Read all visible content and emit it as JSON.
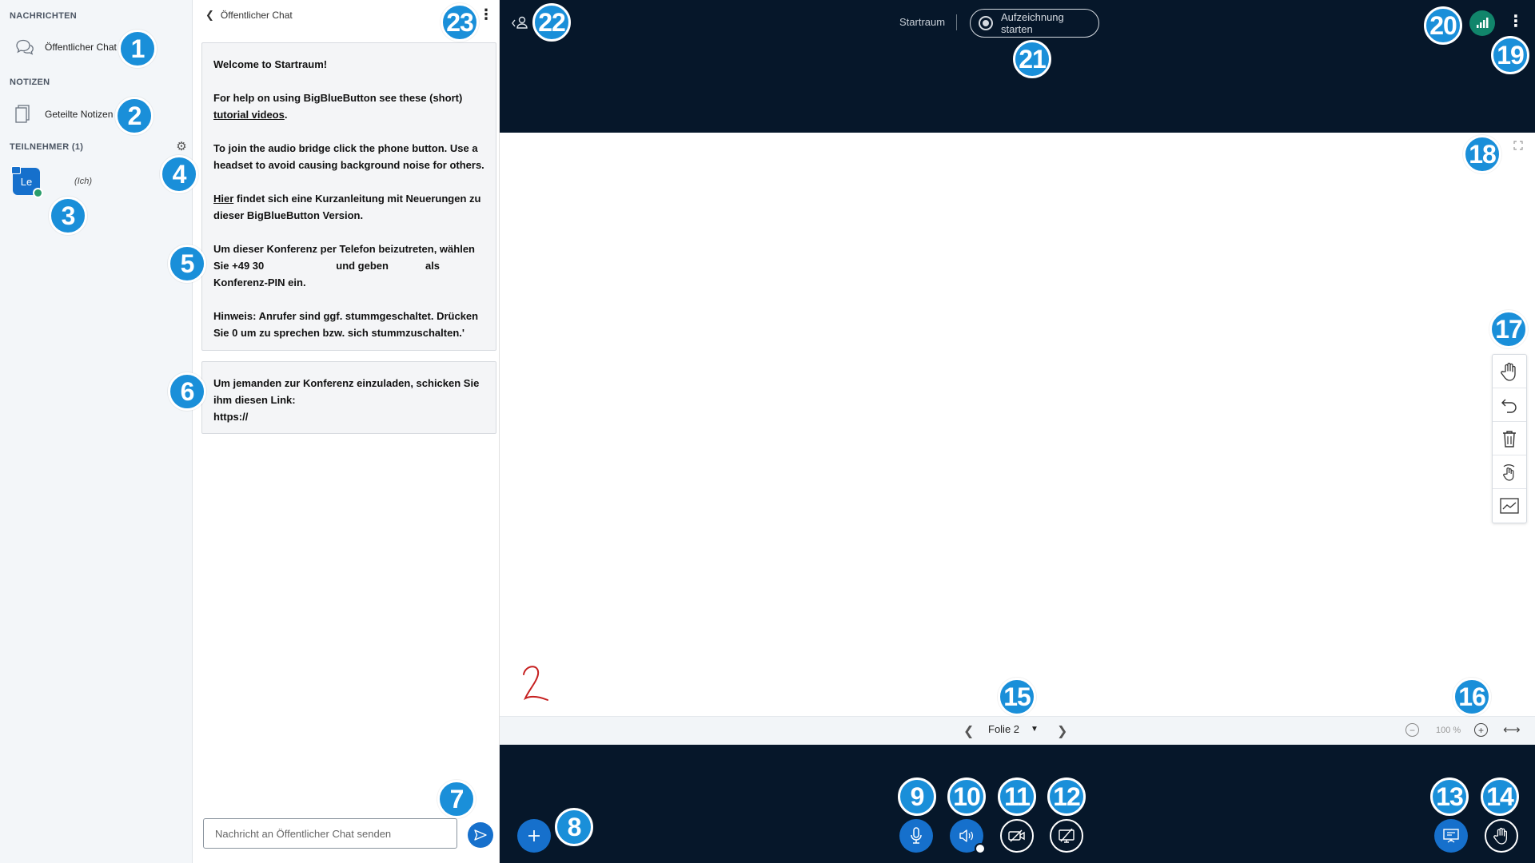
{
  "userlist": {
    "messages_title": "NACHRICHTEN",
    "public_chat_label": "Öffentlicher Chat",
    "notes_title": "NOTIZEN",
    "shared_notes_label": "Geteilte Notizen",
    "participants_title": "TEILNEHMER (1)",
    "user_initials": "Le",
    "user_me_label": "(Ich)"
  },
  "chat": {
    "header_title": "Öffentlicher Chat",
    "welcome": {
      "line1_prefix": "Welcome to ",
      "room": "Startraum",
      "line1_suffix": "!",
      "help_text": "For help on using BigBlueButton see these (short)",
      "help_link": "tutorial videos",
      "help_end": ".",
      "audio_text": "To join the audio bridge click the phone button. Use a headset to avoid causing background noise for others.",
      "here_link": "Hier",
      "here_text": " findet sich eine Kurzanleitung mit Neuerungen zu dieser BigBlueButton Version.",
      "phone_text_1": "Um dieser Konferenz per Telefon beizutreten, wählen Sie +49 30",
      "phone_text_2": "und geben",
      "phone_text_3": "als",
      "phone_text_4": "Konferenz-PIN ein.",
      "hint_label": "Hinweis:",
      "hint_text": " Anrufer sind ggf. stummgeschaltet. Drücken Sie 0 um zu sprechen bzw. sich stummzuschalten.'"
    },
    "invite": {
      "text": "Um jemanden zur Konferenz einzuladen, schicken Sie ihm diesen Link:",
      "link": "https://"
    },
    "input_placeholder": "Nachricht an Öffentlicher Chat senden"
  },
  "topbar": {
    "room_name": "Startraum",
    "record_label": "Aufzeichnung starten"
  },
  "presentation": {
    "slide_label": "Folie 2",
    "zoom_value": "100 %"
  },
  "badges": [
    "1",
    "2",
    "3",
    "4",
    "5",
    "6",
    "7",
    "8",
    "9",
    "10",
    "11",
    "12",
    "13",
    "14",
    "15",
    "16",
    "17",
    "18",
    "19",
    "20",
    "21",
    "22",
    "23"
  ],
  "colors": {
    "dark_bg": "#06172a",
    "accent_blue": "#1670cc",
    "badge_blue": "#1a8fd9",
    "connection_green": "#11856b"
  }
}
